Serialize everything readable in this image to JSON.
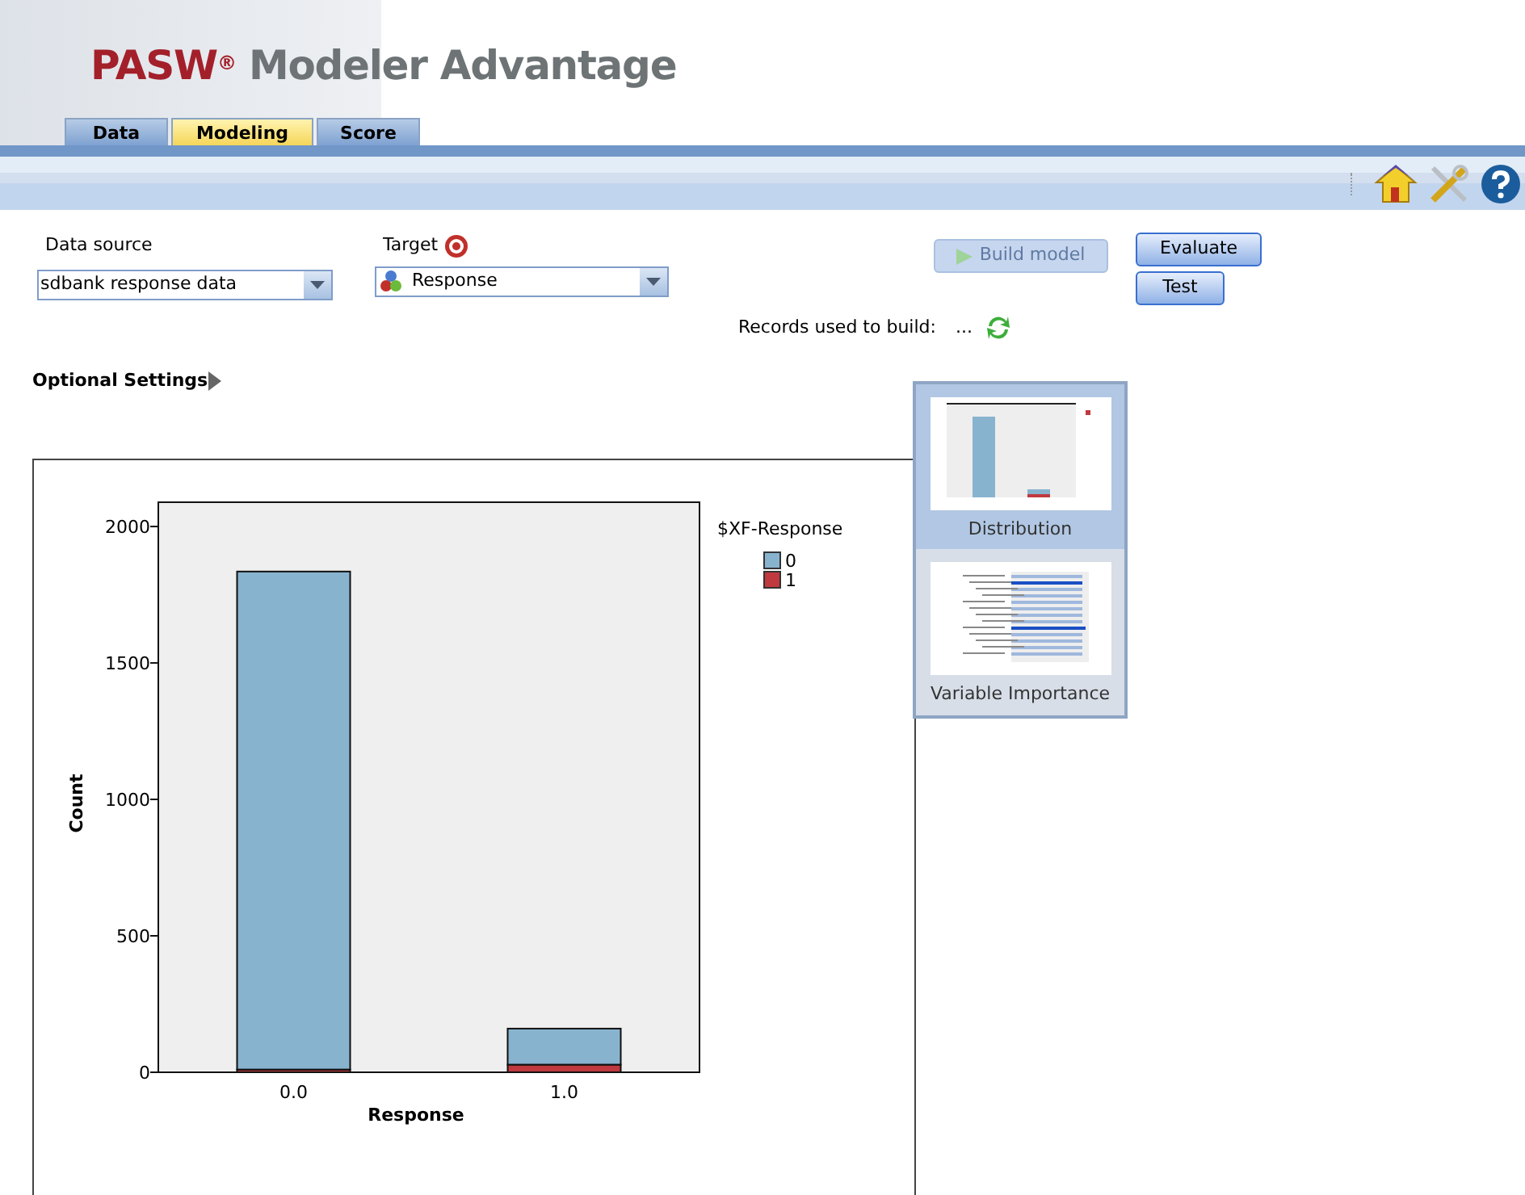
{
  "app": {
    "brand": "PASW",
    "brand_mark": "®",
    "product": "Modeler Advantage"
  },
  "tabs": [
    {
      "label": "Data",
      "selected": false
    },
    {
      "label": "Modeling",
      "selected": true
    },
    {
      "label": "Score",
      "selected": false
    }
  ],
  "form": {
    "data_source": {
      "label": "Data source",
      "value": "sdbank response data"
    },
    "target": {
      "label": "Target",
      "value": "Response"
    },
    "buttons": [
      {
        "label": "Build model",
        "disabled": true
      }
    ],
    "side_buttons": [
      {
        "label": "Evaluate",
        "disabled": false
      },
      {
        "label": "Test",
        "disabled": false
      }
    ],
    "records_label": "Records used to build:",
    "records_value": "...",
    "optional_settings": "Optional Settings"
  },
  "chart_data": {
    "type": "bar",
    "xlabel": "Response",
    "ylabel": "Count",
    "categories": [
      "0.0",
      "1.0"
    ],
    "stacked": true,
    "legend": {
      "title": "$XF-Response"
    },
    "series": [
      {
        "name": "0",
        "color": "#88b3cf",
        "values": [
          1825,
          132
        ]
      },
      {
        "name": "1",
        "color": "#c0393f",
        "values": [
          10,
          28
        ]
      }
    ],
    "ylim": [
      0,
      2089
    ],
    "yticks": [
      0,
      500,
      1000,
      1500,
      2000
    ]
  },
  "views": [
    {
      "label": "Distribution",
      "kind": "distribution",
      "selected": true
    },
    {
      "label": "Variable Importance",
      "kind": "importance",
      "selected": false
    }
  ]
}
